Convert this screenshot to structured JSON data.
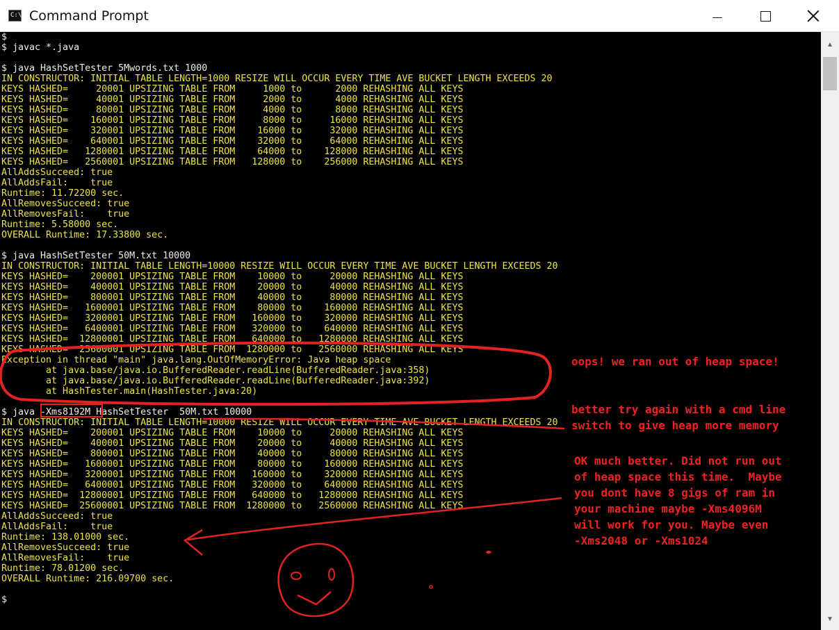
{
  "window": {
    "title": "Command Prompt",
    "icon_text": "C:\\"
  },
  "terminal": {
    "lines": [
      "$",
      "$ javac *.java",
      "",
      "$ java HashSetTester 5Mwords.txt 1000",
      "IN CONSTRUCTOR: INITIAL TABLE LENGTH=1000 RESIZE WILL OCCUR EVERY TIME AVE BUCKET LENGTH EXCEEDS 20",
      "KEYS HASHED=     20001 UPSIZING TABLE FROM     1000 to      2000 REHASHING ALL KEYS",
      "KEYS HASHED=     40001 UPSIZING TABLE FROM     2000 to      4000 REHASHING ALL KEYS",
      "KEYS HASHED=     80001 UPSIZING TABLE FROM     4000 to      8000 REHASHING ALL KEYS",
      "KEYS HASHED=    160001 UPSIZING TABLE FROM     8000 to     16000 REHASHING ALL KEYS",
      "KEYS HASHED=    320001 UPSIZING TABLE FROM    16000 to     32000 REHASHING ALL KEYS",
      "KEYS HASHED=    640001 UPSIZING TABLE FROM    32000 to     64000 REHASHING ALL KEYS",
      "KEYS HASHED=   1280001 UPSIZING TABLE FROM    64000 to    128000 REHASHING ALL KEYS",
      "KEYS HASHED=   2560001 UPSIZING TABLE FROM   128000 to    256000 REHASHING ALL KEYS",
      "AllAddsSucceed: true",
      "AllAddsFail:    true",
      "Runtime: 11.72200 sec.",
      "AllRemovesSucceed: true",
      "AllRemovesFail:    true",
      "Runtime: 5.58000 sec.",
      "OVERALL Runtime: 17.33800 sec.",
      "",
      "$ java HashSetTester 50M.txt 10000",
      "IN CONSTRUCTOR: INITIAL TABLE LENGTH=10000 RESIZE WILL OCCUR EVERY TIME AVE BUCKET LENGTH EXCEEDS 20",
      "KEYS HASHED=    200001 UPSIZING TABLE FROM    10000 to     20000 REHASHING ALL KEYS",
      "KEYS HASHED=    400001 UPSIZING TABLE FROM    20000 to     40000 REHASHING ALL KEYS",
      "KEYS HASHED=    800001 UPSIZING TABLE FROM    40000 to     80000 REHASHING ALL KEYS",
      "KEYS HASHED=   1600001 UPSIZING TABLE FROM    80000 to    160000 REHASHING ALL KEYS",
      "KEYS HASHED=   3200001 UPSIZING TABLE FROM   160000 to    320000 REHASHING ALL KEYS",
      "KEYS HASHED=   6400001 UPSIZING TABLE FROM   320000 to    640000 REHASHING ALL KEYS",
      "KEYS HASHED=  12800001 UPSIZING TABLE FROM   640000 to   1280000 REHASHING ALL KEYS",
      "KEYS HASHED=  25600001 UPSIZING TABLE FROM  1280000 to   2560000 REHASHING ALL KEYS",
      "Exception in thread \"main\" java.lang.OutOfMemoryError: Java heap space",
      "        at java.base/java.io.BufferedReader.readLine(BufferedReader.java:358)",
      "        at java.base/java.io.BufferedReader.readLine(BufferedReader.java:392)",
      "        at HashTester.main(HashTester.java:20)",
      "",
      "$ java -Xms8192M HashSetTester  50M.txt 10000",
      "IN CONSTRUCTOR: INITIAL TABLE LENGTH=10000 RESIZE WILL OCCUR EVERY TIME AVE BUCKET LENGTH EXCEEDS 20",
      "KEYS HASHED=    200001 UPSIZING TABLE FROM    10000 to     20000 REHASHING ALL KEYS",
      "KEYS HASHED=    400001 UPSIZING TABLE FROM    20000 to     40000 REHASHING ALL KEYS",
      "KEYS HASHED=    800001 UPSIZING TABLE FROM    40000 to     80000 REHASHING ALL KEYS",
      "KEYS HASHED=   1600001 UPSIZING TABLE FROM    80000 to    160000 REHASHING ALL KEYS",
      "KEYS HASHED=   3200001 UPSIZING TABLE FROM   160000 to    320000 REHASHING ALL KEYS",
      "KEYS HASHED=   6400001 UPSIZING TABLE FROM   320000 to    640000 REHASHING ALL KEYS",
      "KEYS HASHED=  12800001 UPSIZING TABLE FROM   640000 to   1280000 REHASHING ALL KEYS",
      "KEYS HASHED=  25600001 UPSIZING TABLE FROM  1280000 to   2560000 REHASHING ALL KEYS",
      "AllAddsSucceed: true",
      "AllAddsFail:    true",
      "Runtime: 138.01000 sec.",
      "AllRemovesSucceed: true",
      "AllRemovesFail:    true",
      "Runtime: 78.01200 sec.",
      "OVERALL Runtime: 216.09700 sec.",
      "",
      "$"
    ]
  },
  "annotations": {
    "oops": "oops! we ran out of heap space!",
    "retry": "better try again with a cmd line\nswitch to give heap more memory",
    "better": "OK much better. Did not run out\nof heap space this time.  Maybe\nyou dont have 8 gigs of ram in\nyour machine maybe -Xms4096M\nwill work for you. Maybe even\n-Xms2048 or -Xms1024"
  },
  "colors": {
    "console_text": "#efe24d",
    "command_text": "#f2f0e4",
    "annotation": "#ee2222"
  }
}
